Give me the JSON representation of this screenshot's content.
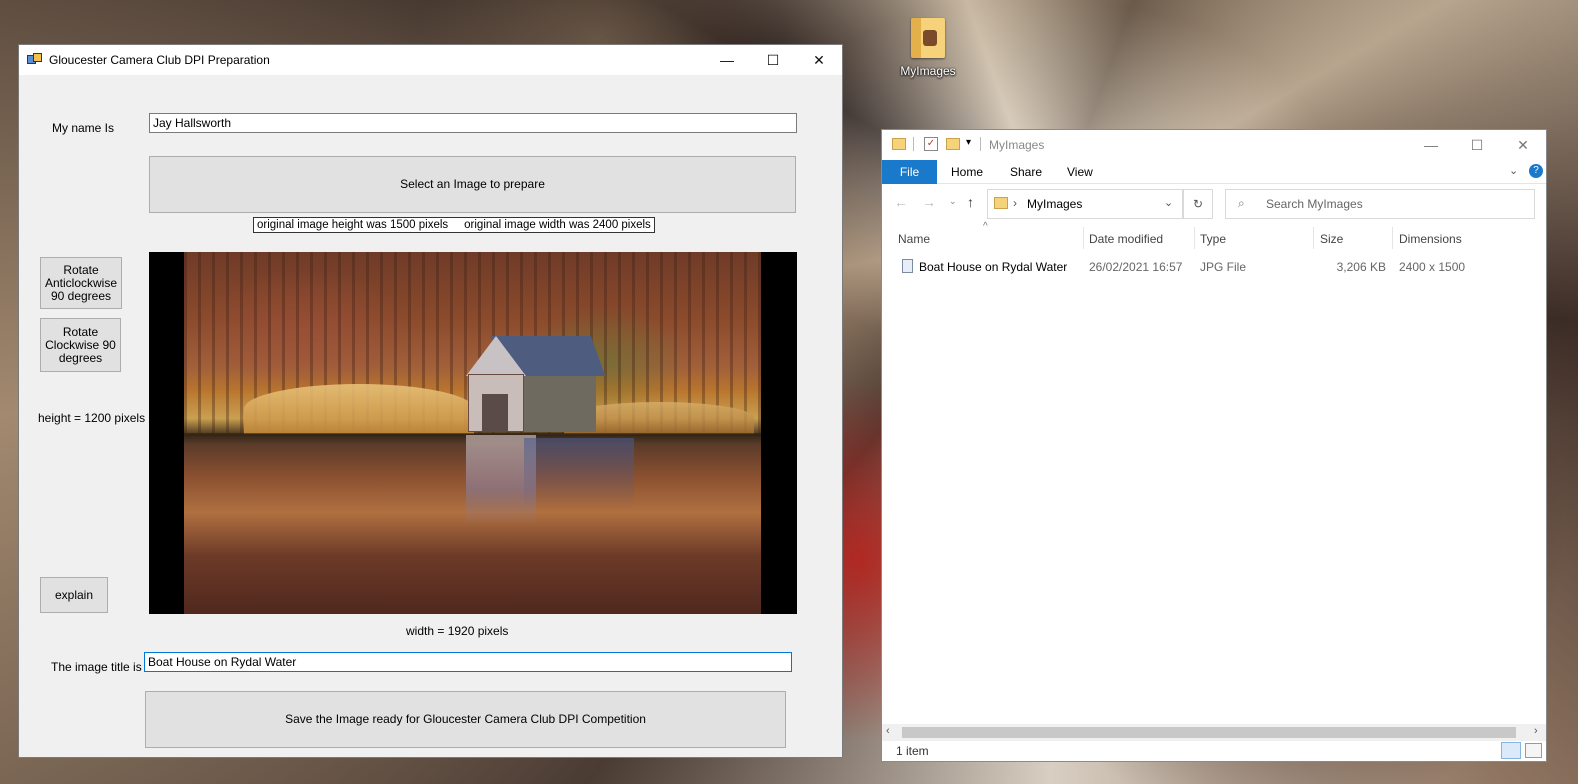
{
  "desktop": {
    "icon_label": "MyImages"
  },
  "app": {
    "title": "Gloucester Camera Club DPI Preparation",
    "controls": {
      "minimize": "—",
      "maximize": "☐",
      "close": "✕"
    },
    "name_label": "My name Is",
    "name_value": "Jay Hallsworth",
    "select_button": "Select an Image to prepare",
    "original_height": "original image height was 1500 pixels",
    "original_width": "original image width was 2400 pixels",
    "rotate_anticlockwise": "Rotate Anticlockwise 90 degrees",
    "rotate_clockwise": "Rotate Clockwise  90 degrees",
    "height_label": "height = 1200 pixels",
    "explain_button": "explain",
    "width_label": "width = 1920 pixels",
    "title_label": "The image title is",
    "title_value": "Boat House on Rydal Water",
    "save_button": "Save the Image ready for Gloucester Camera Club DPI Competition"
  },
  "explorer": {
    "title": "MyImages",
    "controls": {
      "minimize": "—",
      "maximize": "☐",
      "close": "✕"
    },
    "ribbon_tabs": [
      "File",
      "Home",
      "Share",
      "View"
    ],
    "address_path": "MyImages",
    "search_placeholder": "Search MyImages",
    "columns": [
      "Name",
      "Date modified",
      "Type",
      "Size",
      "Dimensions"
    ],
    "files": [
      {
        "name": "Boat House on Rydal Water",
        "date": "26/02/2021 16:57",
        "type": "JPG File",
        "size": "3,206 KB",
        "dimensions": "2400 x 1500"
      }
    ],
    "status": "1 item",
    "colors": {
      "accent": "#1979ca"
    }
  }
}
